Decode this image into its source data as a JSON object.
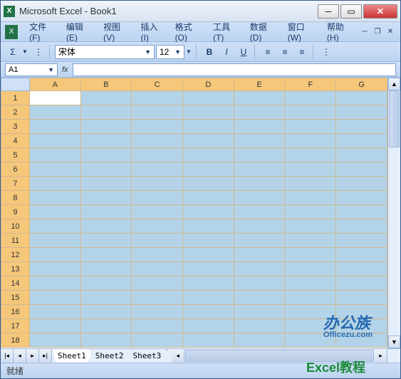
{
  "title": "Microsoft Excel - Book1",
  "menu": {
    "file": "文件(F)",
    "edit": "编辑(E)",
    "view": "视图(V)",
    "insert": "插入(I)",
    "format": "格式(O)",
    "tools": "工具(T)",
    "data": "数据(D)",
    "window": "窗口(W)",
    "help": "帮助(H)"
  },
  "font": {
    "name": "宋体",
    "size": "12"
  },
  "namebox": "A1",
  "columns": [
    "A",
    "B",
    "C",
    "D",
    "E",
    "F",
    "G"
  ],
  "rows": [
    "1",
    "2",
    "3",
    "4",
    "5",
    "6",
    "7",
    "8",
    "9",
    "10",
    "11",
    "12",
    "13",
    "14",
    "15",
    "16",
    "17",
    "18"
  ],
  "active_cell": "A1",
  "sheets": [
    "Sheet1",
    "Sheet2",
    "Sheet3"
  ],
  "active_sheet": 0,
  "status": "就绪",
  "watermark": {
    "brand": "办公族",
    "url": "Officezu.com",
    "tutorial": "Excel教程"
  }
}
